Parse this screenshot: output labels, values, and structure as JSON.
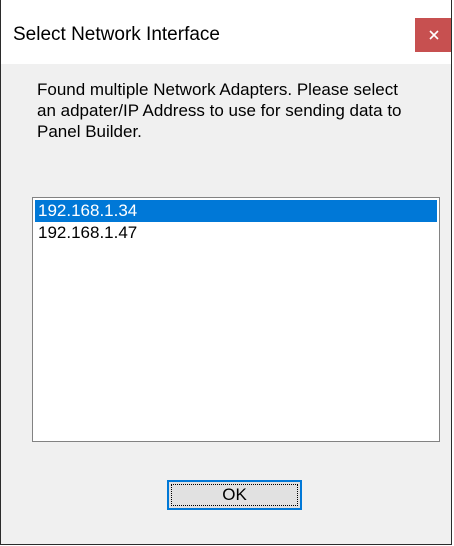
{
  "window": {
    "title": "Select Network Interface",
    "close_icon": "close-icon"
  },
  "message": {
    "text": "Found multiple Network Adapters. Please select an adpater/IP Address to use for sending data to Panel Builder."
  },
  "adapter_list": {
    "items": [
      {
        "label": "192.168.1.34",
        "selected": true
      },
      {
        "label": "192.168.1.47",
        "selected": false
      }
    ]
  },
  "buttons": {
    "ok_label": "OK"
  },
  "colors": {
    "selection": "#0078d7",
    "close_button": "#c75050",
    "dialog_background": "#f0f0f0"
  }
}
